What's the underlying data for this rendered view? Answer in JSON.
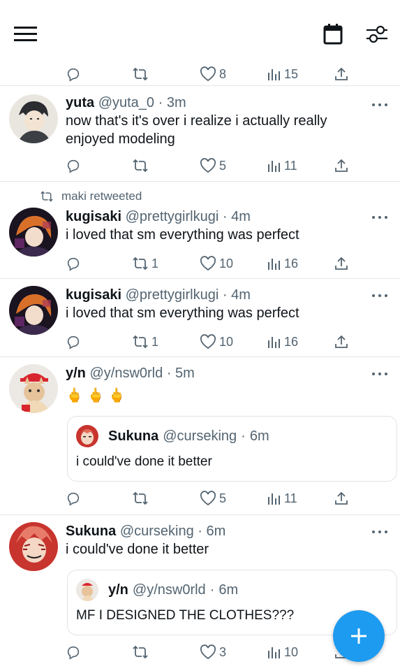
{
  "colors": {
    "accent": "#1d9bf0",
    "muted": "#536471",
    "text": "#0f1419"
  },
  "topbar": {
    "menu_icon": "hamburger-menu-icon",
    "calendar_icon": "calendar-icon",
    "filter_icon": "sliders-filter-icon"
  },
  "first_actions": {
    "likes": "8",
    "views": "15"
  },
  "tweets": [
    {
      "name": "yuta",
      "handle": "@yuta_0",
      "time": "3m",
      "text": "now that's it's over i realize i actually really enjoyed modeling",
      "retweets": "",
      "likes": "5",
      "views": "11"
    },
    {
      "retweeted_by": "maki retweeted",
      "name": "kugisaki",
      "handle": "@prettygirlkugi",
      "time": "4m",
      "text": "i loved that sm everything was perfect",
      "retweets": "1",
      "likes": "10",
      "views": "16"
    },
    {
      "name": "kugisaki",
      "handle": "@prettygirlkugi",
      "time": "4m",
      "text": "i loved that sm everything was perfect",
      "retweets": "1",
      "likes": "10",
      "views": "16"
    },
    {
      "name": "y/n",
      "handle": "@y/nsw0rld",
      "time": "5m",
      "text": "🖕 🖕 🖕",
      "quote": {
        "name": "Sukuna",
        "handle": "@curseking",
        "time": "6m",
        "text": "i could've done it better"
      },
      "retweets": "",
      "likes": "5",
      "views": "11"
    },
    {
      "name": "Sukuna",
      "handle": "@curseking",
      "time": "6m",
      "text": "i could've done it better",
      "quote": {
        "name": "y/n",
        "handle": "@y/nsw0rld",
        "time": "6m",
        "text": "MF I DESIGNED THE CLOTHES???"
      },
      "retweets": "",
      "likes": "3",
      "views": "10"
    }
  ],
  "dot": "·",
  "fab": {
    "icon": "plus-compose-icon"
  }
}
